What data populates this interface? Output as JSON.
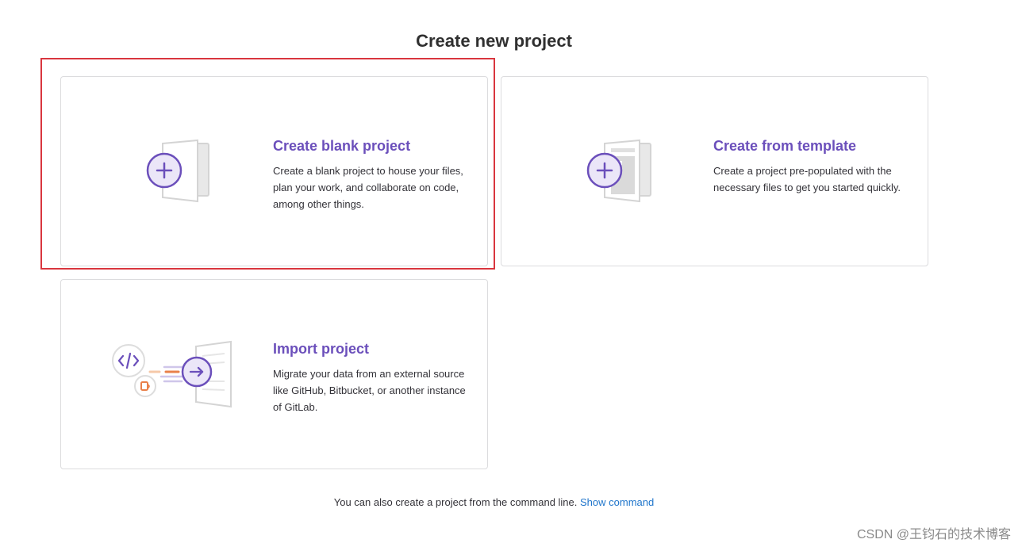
{
  "page": {
    "title": "Create new project"
  },
  "cards": {
    "blank": {
      "title": "Create blank project",
      "description": "Create a blank project to house your files, plan your work, and collaborate on code, among other things.",
      "icon": "blank-project-illustration"
    },
    "template": {
      "title": "Create from template",
      "description": "Create a project pre-populated with the necessary files to get you started quickly.",
      "icon": "template-project-illustration"
    },
    "import": {
      "title": "Import project",
      "description": "Migrate your data from an external source like GitHub, Bitbucket, or another instance of GitLab.",
      "icon": "import-project-illustration"
    }
  },
  "footer": {
    "text": "You can also create a project from the command line.",
    "link": "Show command"
  },
  "watermark": "CSDN @王钧石的技术博客",
  "colors": {
    "accent": "#6b4fbb",
    "link": "#1f75cb",
    "highlight": "#d9363e"
  }
}
